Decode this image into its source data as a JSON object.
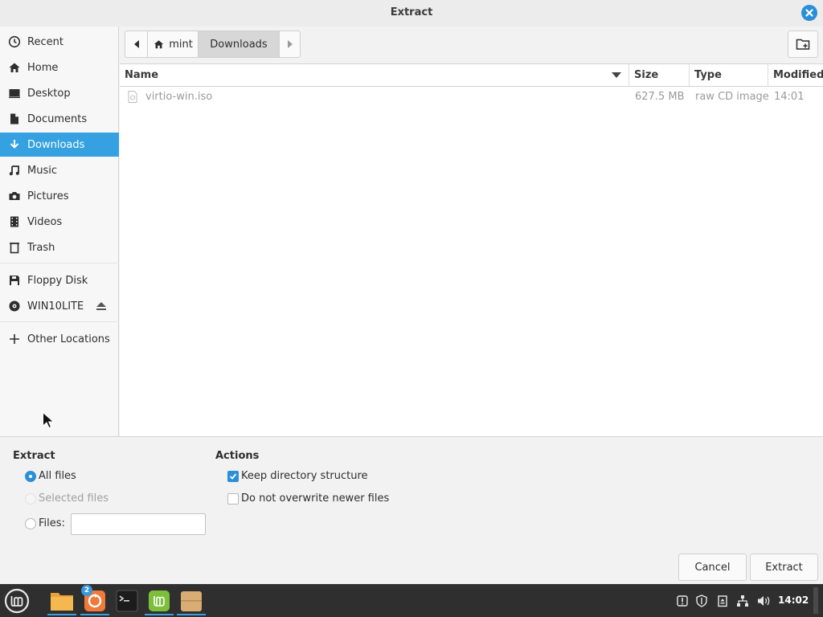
{
  "window": {
    "title": "Extract"
  },
  "sidebar": {
    "items": [
      {
        "label": "Recent",
        "icon": "clock-icon"
      },
      {
        "label": "Home",
        "icon": "home-icon"
      },
      {
        "label": "Desktop",
        "icon": "desktop-icon"
      },
      {
        "label": "Documents",
        "icon": "document-icon"
      },
      {
        "label": "Downloads",
        "icon": "download-icon",
        "active": true
      },
      {
        "label": "Music",
        "icon": "music-icon"
      },
      {
        "label": "Pictures",
        "icon": "camera-icon"
      },
      {
        "label": "Videos",
        "icon": "film-icon"
      },
      {
        "label": "Trash",
        "icon": "trash-icon"
      }
    ],
    "devices": [
      {
        "label": "Floppy Disk",
        "icon": "floppy-icon"
      },
      {
        "label": "WIN10LITE",
        "icon": "disc-icon"
      }
    ],
    "other": {
      "label": "Other Locations",
      "icon": "plus-icon"
    }
  },
  "pathbar": {
    "segments": [
      "mint",
      "Downloads"
    ]
  },
  "filelist": {
    "columns": [
      "Name",
      "Size",
      "Type",
      "Modified"
    ],
    "rows": [
      {
        "name": "virtio-win.iso",
        "size": "627.5 MB",
        "type": "raw CD image",
        "modified": "14:01"
      }
    ]
  },
  "extract_group": {
    "title": "Extract",
    "options": [
      "All files",
      "Selected files",
      "Files:"
    ],
    "selected": "All files",
    "files_value": ""
  },
  "actions_group": {
    "title": "Actions",
    "options": [
      {
        "label": "Keep directory structure",
        "checked": true
      },
      {
        "label": "Do not overwrite newer files",
        "checked": false
      }
    ]
  },
  "buttons": {
    "cancel": "Cancel",
    "extract": "Extract"
  },
  "taskbar": {
    "badge": "2",
    "clock": "14:02"
  },
  "colors": {
    "accent": "#35a1e0",
    "taskbar": "#2f2f2f"
  }
}
